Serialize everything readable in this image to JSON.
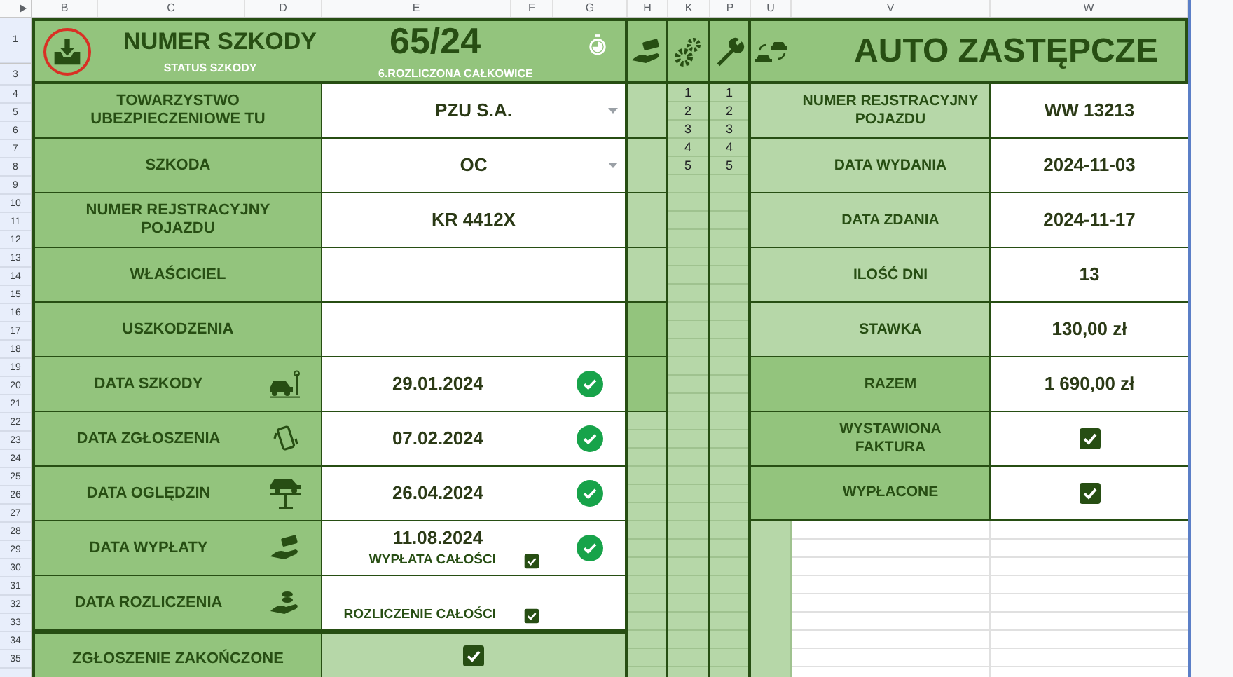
{
  "column_headers": [
    "B",
    "C",
    "D",
    "E",
    "F",
    "G",
    "H",
    "K",
    "P",
    "U",
    "V",
    "W"
  ],
  "row_numbers": [
    "1",
    "3",
    "4",
    "5",
    "6",
    "7",
    "8",
    "9",
    "10",
    "11",
    "12",
    "13",
    "14",
    "15",
    "16",
    "17",
    "18",
    "19",
    "20",
    "21",
    "22",
    "23",
    "24",
    "25",
    "26",
    "27",
    "28",
    "29",
    "30",
    "31",
    "32",
    "33",
    "34",
    "35"
  ],
  "claim": {
    "title": "NUMER SZKODY",
    "number": "65/24",
    "status_label": "STATUS SZKODY",
    "status": "6.ROZLICZONA CAŁKOWICE"
  },
  "fields": [
    {
      "kind": "dropdown",
      "label": "TOWARZYSTWO\nUBEZPIECZENIOWE TU",
      "value": "PZU S.A."
    },
    {
      "kind": "dropdown",
      "label": "SZKODA",
      "value": "OC"
    },
    {
      "kind": "text",
      "label": "NUMER REJSTRACYJNY\nPOJAZDU",
      "value": "KR 4412X"
    },
    {
      "kind": "text",
      "label": "WŁAŚCICIEL"
    },
    {
      "kind": "text",
      "label": "USZKODZENIA"
    },
    {
      "kind": "date",
      "label": "DATA SZKODY",
      "value": "29.01.2024",
      "done": true
    },
    {
      "kind": "date",
      "label": "DATA ZGŁOSZENIA",
      "value": "07.02.2024",
      "done": true
    },
    {
      "kind": "date",
      "label": "DATA OGLĘDZIN",
      "value": "26.04.2024",
      "done": true
    },
    {
      "kind": "date",
      "label": "DATA WYPŁATY",
      "value": "11.08.2024",
      "done": true,
      "sub": {
        "label": "WYPŁATA CAŁOŚCI",
        "checked": true
      }
    },
    {
      "kind": "date",
      "label": "DATA ROZLICZENIA",
      "done": false,
      "sub": {
        "label": "ROZLICZENIE CAŁOŚCI",
        "checked": true
      }
    },
    {
      "kind": "final",
      "label": "ZGŁOSZENIE ZAKOŃCZONE",
      "checked": true
    }
  ],
  "k_numbers": [
    "1",
    "2",
    "3",
    "4",
    "5"
  ],
  "p_numbers": [
    "1",
    "2",
    "3",
    "4",
    "5"
  ],
  "replacement_car": {
    "title": "AUTO ZASTĘPCZE",
    "fields": [
      {
        "kind": "text",
        "label": "NUMER REJSTRACYJNY\nPOJAZDU",
        "value": "WW 13213",
        "emphasis": false
      },
      {
        "kind": "text",
        "label": "DATA WYDANIA",
        "value": "2024-11-03",
        "emphasis": false
      },
      {
        "kind": "text",
        "label": "DATA ZDANIA",
        "value": "2024-11-17",
        "emphasis": false
      },
      {
        "kind": "text",
        "label": "ILOŚĆ DNI",
        "value": "13",
        "emphasis": false
      },
      {
        "kind": "text",
        "label": "STAWKA",
        "value": "130,00 zł",
        "emphasis": false
      },
      {
        "kind": "text",
        "label": "RAZEM",
        "value": "1 690,00 zł",
        "emphasis": true
      },
      {
        "kind": "checkbox",
        "label": "WYSTAWIONA\nFAKTURA",
        "checked": true,
        "emphasis": true
      },
      {
        "kind": "checkbox",
        "label": "WYPŁACONE",
        "checked": true,
        "emphasis": true
      }
    ]
  }
}
